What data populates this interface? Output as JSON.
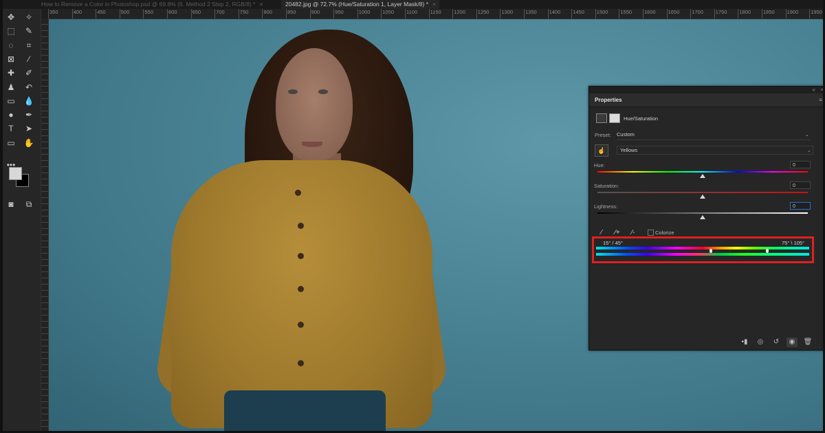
{
  "tabs": [
    {
      "label": "How to Remove a Color in Photoshop.psd @ 69.8% (6. Method 2 Step 2, RGB/8) *"
    },
    {
      "label": "20482.jpg @ 72.7% (Hue/Saturation 1, Layer Mask/8) *"
    }
  ],
  "tab_close": "×",
  "ruler": {
    "ticks": [
      "350",
      "400",
      "450",
      "500",
      "550",
      "600",
      "650",
      "700",
      "750",
      "800",
      "850",
      "900",
      "950",
      "1000",
      "1050",
      "1100",
      "1150",
      "1200",
      "1250",
      "1300",
      "1350",
      "1400",
      "1450",
      "1500",
      "1550",
      "1600",
      "1650",
      "1700",
      "1750",
      "1800",
      "1850",
      "1900",
      "1950"
    ]
  },
  "toolbar": {
    "tools": [
      {
        "name": "move-tool-icon",
        "glyph": "✥"
      },
      {
        "name": "magic-wand-tool-icon",
        "glyph": "✧"
      },
      {
        "name": "marquee-tool-icon",
        "glyph": "⬚"
      },
      {
        "name": "quick-select-tool-icon",
        "glyph": "✎"
      },
      {
        "name": "lasso-tool-icon",
        "glyph": "◌"
      },
      {
        "name": "crop-tool-icon",
        "glyph": "⌗"
      },
      {
        "name": "frame-tool-icon",
        "glyph": "⊠"
      },
      {
        "name": "eyedropper-tool-icon",
        "glyph": "⁄"
      },
      {
        "name": "healing-brush-tool-icon",
        "glyph": "✚"
      },
      {
        "name": "brush-tool-icon",
        "glyph": "✐"
      },
      {
        "name": "clone-stamp-tool-icon",
        "glyph": "♟"
      },
      {
        "name": "history-brush-tool-icon",
        "glyph": "↶"
      },
      {
        "name": "eraser-tool-icon",
        "glyph": "▭"
      },
      {
        "name": "blur-tool-icon",
        "glyph": "💧"
      },
      {
        "name": "dodge-tool-icon",
        "glyph": "●"
      },
      {
        "name": "pen-tool-icon",
        "glyph": "✒"
      },
      {
        "name": "type-tool-icon",
        "glyph": "T"
      },
      {
        "name": "path-select-tool-icon",
        "glyph": "➤"
      },
      {
        "name": "rectangle-tool-icon",
        "glyph": "▭"
      },
      {
        "name": "hand-tool-icon",
        "glyph": "✋"
      },
      {
        "name": "more-tools-icon",
        "glyph": "•••"
      },
      {
        "name": "quick-mask-icon",
        "glyph": "◙"
      },
      {
        "name": "screen-mode-icon",
        "glyph": "⧉"
      }
    ],
    "fg_color": "#d8d8d8",
    "bg_color": "#000000"
  },
  "properties": {
    "title": "Properties",
    "menu_glyph": "≡",
    "collapse_glyph": "«",
    "close_glyph": "×",
    "adjustment_name": "Hue/Saturation",
    "preset_label": "Preset:",
    "preset_value": "Custom",
    "channel_value": "Yellows",
    "hue_label": "Hue:",
    "hue_value": "0",
    "saturation_label": "Saturation:",
    "saturation_value": "0",
    "lightness_label": "Lightness:",
    "lightness_value": "0",
    "colorize_label": "Colorize",
    "range_left": "15° / 45°",
    "range_right": "75° \\ 105°",
    "chevron": "⌄",
    "footer_icons": [
      {
        "name": "clip-to-layer-icon",
        "glyph": "▪▮"
      },
      {
        "name": "view-previous-state-icon",
        "glyph": "◎"
      },
      {
        "name": "reset-icon",
        "glyph": "↺"
      },
      {
        "name": "visibility-eye-icon",
        "glyph": "◉"
      },
      {
        "name": "delete-icon",
        "glyph": "🗑"
      }
    ]
  },
  "colors": {
    "highlight_frame": "#e02020",
    "accent": "#2a6fc9"
  }
}
